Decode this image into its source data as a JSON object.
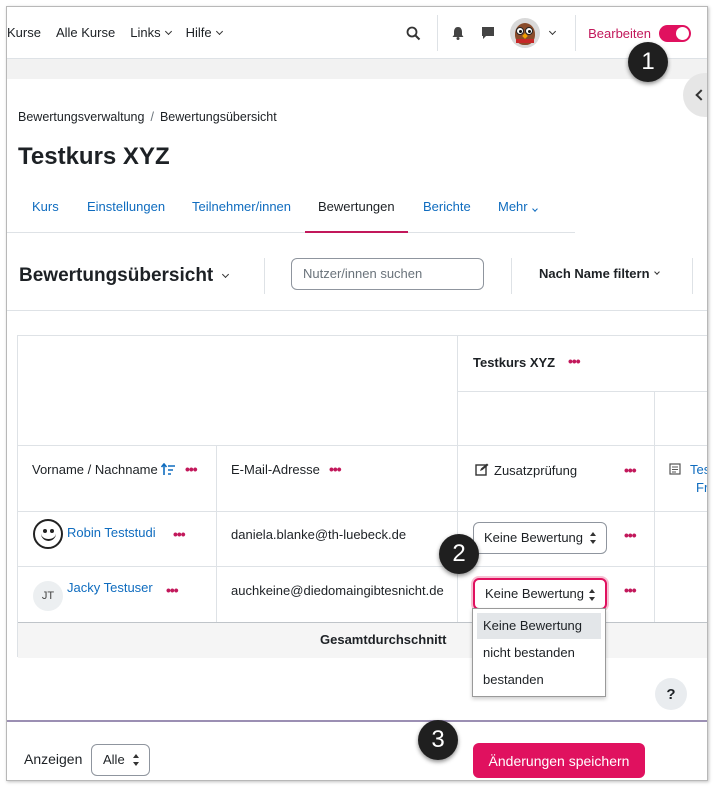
{
  "nav": {
    "items": [
      {
        "label": "Kurse",
        "has_menu": false
      },
      {
        "label": "Alle Kurse",
        "has_menu": false
      },
      {
        "label": "Links",
        "has_menu": true
      },
      {
        "label": "Hilfe",
        "has_menu": true
      }
    ],
    "edit_mode_label": "Bearbeiten",
    "edit_mode_on": true
  },
  "callouts": [
    "1",
    "2",
    "3"
  ],
  "breadcrumb": [
    "Bewertungsverwaltung",
    "Bewertungsübersicht"
  ],
  "page_title": "Testkurs XYZ",
  "tabs": [
    {
      "label": "Kurs",
      "active": false
    },
    {
      "label": "Einstellungen",
      "active": false
    },
    {
      "label": "Teilnehmer/innen",
      "active": false
    },
    {
      "label": "Bewertungen",
      "active": true
    },
    {
      "label": "Berichte",
      "active": false
    },
    {
      "label": "Mehr",
      "active": false
    }
  ],
  "toolbar": {
    "report_selector": "Bewertungsübersicht",
    "search_placeholder": "Nutzer/innen suchen",
    "filter_label": "Nach Name filtern"
  },
  "grid": {
    "course_header": "Testkurs XYZ",
    "col_name": "Vorname / Nachname",
    "col_email": "E-Mail-Adresse",
    "col_item": "Zusatzprüfung",
    "col_item2_partial": "Tes",
    "col_item2_partial_line2": "Fr",
    "rows": [
      {
        "initials": "",
        "name": "Robin Teststudi",
        "email": "daniela.blanke@th-luebeck.de",
        "grade": "Keine Bewertung"
      },
      {
        "initials": "JT",
        "name": "Jacky Testuser",
        "email": "auchkeine@diedomaingibtesnicht.de",
        "grade": "Keine Bewertung"
      }
    ],
    "overall_average_label": "Gesamtdurchschnitt"
  },
  "grade_options": [
    "Keine Bewertung",
    "nicht bestanden",
    "bestanden"
  ],
  "footer": {
    "show_label": "Anzeigen",
    "per_page_value": "Alle",
    "save_label": "Änderungen speichern"
  },
  "colors": {
    "accent": "#e0115f",
    "link": "#0f6cbf"
  }
}
